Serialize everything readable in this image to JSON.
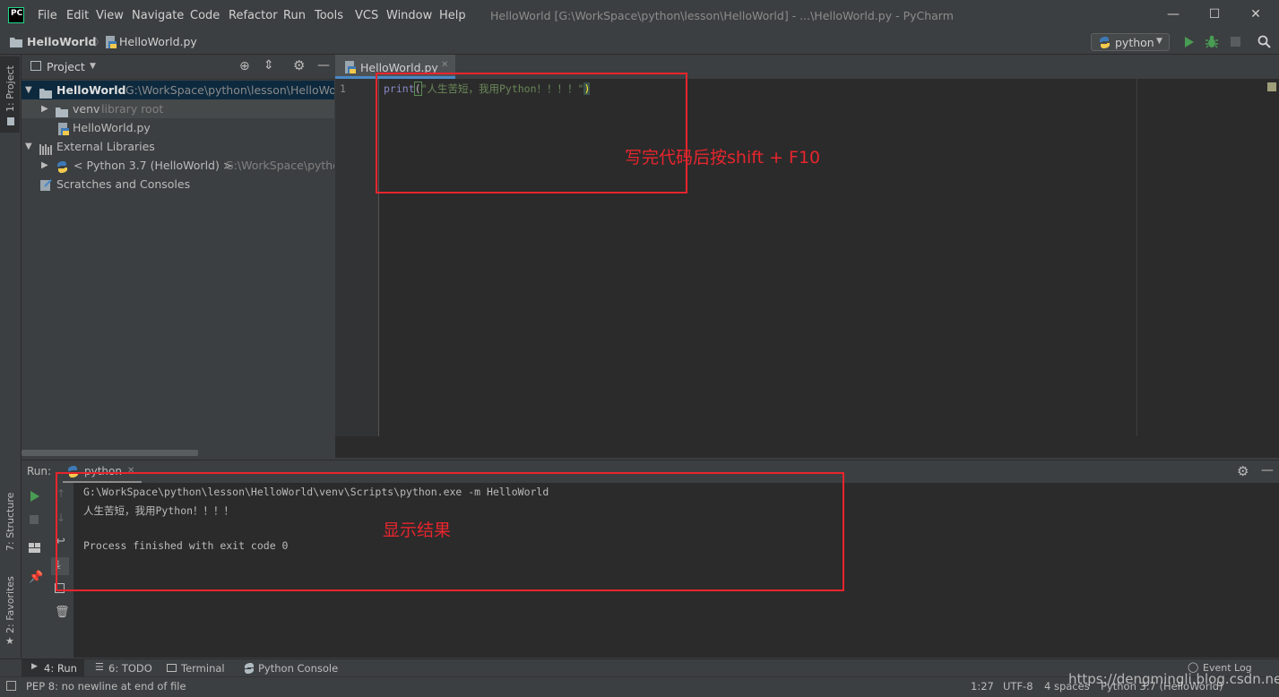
{
  "window": {
    "logo": "PC",
    "title": "HelloWorld [G:\\WorkSpace\\python\\lesson\\HelloWorld] - ...\\HelloWorld.py - PyCharm",
    "menu": [
      "File",
      "Edit",
      "View",
      "Navigate",
      "Code",
      "Refactor",
      "Run",
      "Tools",
      "VCS",
      "Window",
      "Help"
    ],
    "controls": {
      "minimize": "—",
      "maximize": "☐",
      "close": "✕"
    }
  },
  "navbar": {
    "project": "HelloWorld",
    "file": "HelloWorld.py",
    "run_config": "python"
  },
  "left_strip": {
    "project": "1: Project",
    "structure": "7: Structure",
    "favorites": "2: Favorites"
  },
  "project_panel": {
    "title": "Project",
    "tree": [
      {
        "label": "HelloWorld",
        "extra": "G:\\WorkSpace\\python\\lesson\\HelloWorld"
      },
      {
        "label": "venv",
        "extra": "library root"
      },
      {
        "label": "HelloWorld.py",
        "extra": ""
      },
      {
        "label": "External Libraries",
        "extra": ""
      },
      {
        "label": "< Python 3.7 (HelloWorld) >",
        "extra": "G:\\WorkSpace\\python"
      },
      {
        "label": "Scratches and Consoles",
        "extra": ""
      }
    ]
  },
  "editor": {
    "tab": "HelloWorld.py",
    "line_number": "1",
    "code": {
      "fn": "print",
      "open": "(",
      "string": "\"人生苦短，我用Python！！！！\"",
      "close": ")"
    }
  },
  "run_panel": {
    "label": "Run:",
    "tab": "python",
    "console": [
      "G:\\WorkSpace\\python\\lesson\\HelloWorld\\venv\\Scripts\\python.exe -m HelloWorld",
      "人生苦短，我用Python！！！！",
      "",
      "Process finished with exit code 0"
    ]
  },
  "annotations": {
    "editor_note": "写完代码后按shift + F10",
    "console_note": "显示结果"
  },
  "tool_tabs": [
    "4: Run",
    "6: TODO",
    "Terminal",
    "Python Console"
  ],
  "event_log": "Event Log",
  "status": {
    "message": "PEP 8: no newline at end of file",
    "position": "1:27",
    "encoding": "UTF-8",
    "indent": "4 spaces",
    "interpreter": "Python 3.7 (HelloWorld)"
  },
  "watermark": "https://dengmingli.blog.csdn.net",
  "colors": {
    "accent": "#4a88c7",
    "annotation": "#e8252d",
    "run_green": "#499c54",
    "string_green": "#6a8759"
  }
}
